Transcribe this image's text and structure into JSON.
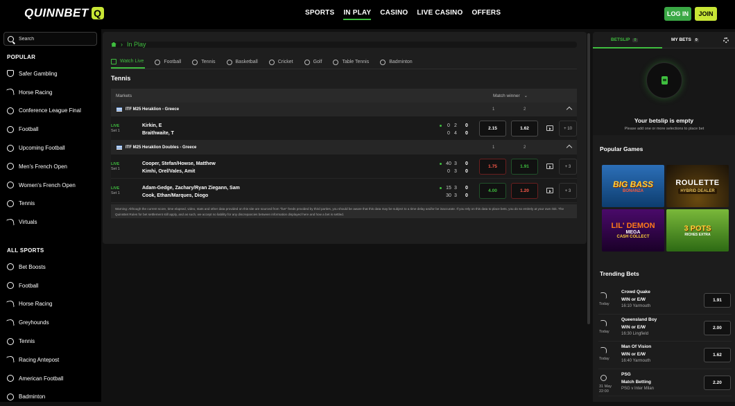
{
  "header": {
    "logo_text": "QUINNBET",
    "logo_mark": "Q",
    "nav": [
      "SPORTS",
      "IN PLAY",
      "CASINO",
      "LIVE CASINO",
      "OFFERS"
    ],
    "active_nav": "IN PLAY",
    "login_label": "LOG IN",
    "join_label": "JOIN",
    "accent_color": "#3fbf3f",
    "join_color": "#c8e635"
  },
  "sidebar": {
    "search_placeholder": "Search",
    "popular_title": "POPULAR",
    "popular": [
      {
        "label": "Safer Gambling",
        "icon": "shield-icon"
      },
      {
        "label": "Horse Racing",
        "icon": "horse-icon"
      },
      {
        "label": "Conference League Final",
        "icon": "football-icon"
      },
      {
        "label": "Football",
        "icon": "football-icon"
      },
      {
        "label": "Upcoming Football",
        "icon": "football-icon"
      },
      {
        "label": "Men's French Open",
        "icon": "tennis-icon"
      },
      {
        "label": "Women's French Open",
        "icon": "tennis-icon"
      },
      {
        "label": "Tennis",
        "icon": "tennis-icon"
      },
      {
        "label": "Virtuals",
        "icon": "horse-icon"
      }
    ],
    "all_sports_title": "ALL SPORTS",
    "all_sports": [
      {
        "label": "Bet Boosts",
        "icon": "boost-icon"
      },
      {
        "label": "Football",
        "icon": "football-icon"
      },
      {
        "label": "Horse Racing",
        "icon": "horse-icon"
      },
      {
        "label": "Greyhounds",
        "icon": "greyhound-icon"
      },
      {
        "label": "Tennis",
        "icon": "tennis-icon"
      },
      {
        "label": "Racing Antepost",
        "icon": "horse-icon"
      },
      {
        "label": "American Football",
        "icon": "american-football-icon"
      },
      {
        "label": "Badminton",
        "icon": "badminton-icon"
      }
    ]
  },
  "main": {
    "breadcrumb": "In Play",
    "tabs": [
      {
        "label": "Watch Live",
        "icon": "tv-icon",
        "active": true
      },
      {
        "label": "Football",
        "icon": "football-icon",
        "active": false
      },
      {
        "label": "Tennis",
        "icon": "tennis-icon",
        "active": false
      },
      {
        "label": "Basketball",
        "icon": "basketball-icon",
        "active": false
      },
      {
        "label": "Cricket",
        "icon": "cricket-icon",
        "active": false
      },
      {
        "label": "Golf",
        "icon": "golf-icon",
        "active": false
      },
      {
        "label": "Table Tennis",
        "icon": "table-tennis-icon",
        "active": false
      },
      {
        "label": "Badminton",
        "icon": "badminton-icon",
        "active": false
      }
    ],
    "sport_heading": "Tennis",
    "table_header": {
      "markets": "Markets",
      "match_winner": "Match winner"
    },
    "competitions": [
      {
        "name": "ITF M25 Heraklion - Greece",
        "col1": "1",
        "col2": "2",
        "events": [
          {
            "live": "LIVE",
            "set": "Set 1",
            "team1": "Kirkin, E",
            "team2": "Braithwaite, T",
            "score1": [
              "0",
              "2",
              "0"
            ],
            "score2": [
              "0",
              "4",
              "0"
            ],
            "odd1": "2.15",
            "odd2": "1.62",
            "odd1_trend": "",
            "odd2_trend": "",
            "more": "+ 10"
          }
        ]
      },
      {
        "name": "ITF M25 Heraklion Doubles - Greece",
        "col1": "1",
        "col2": "2",
        "events": [
          {
            "live": "LIVE",
            "set": "Set 1",
            "team1": "Cooper, Stefan/Howse, Matthew",
            "team2": "Kimhi, Orel/Vales, Amit",
            "score1": [
              "40",
              "3",
              "0"
            ],
            "score2": [
              "0",
              "3",
              "0"
            ],
            "odd1": "1.75",
            "odd2": "1.91",
            "odd1_trend": "down",
            "odd2_trend": "up",
            "more": "+ 3"
          },
          {
            "live": "LIVE",
            "set": "Set 1",
            "team1": "Adam-Gedge, Zachary/Ryan Ziegann, Sam",
            "team2": "Cook, Ethan/Marques, Diogo",
            "score1": [
              "15",
              "3",
              "0"
            ],
            "score2": [
              "30",
              "3",
              "0"
            ],
            "odd1": "4.00",
            "odd2": "1.20",
            "odd1_trend": "up",
            "odd2_trend": "down",
            "more": "+ 3"
          }
        ]
      }
    ],
    "warning": "Warning: Although the current score, time elapsed, video, stats and other data provided on this site are sourced from \"live\" feeds provided by third parties, you should be aware that this data may be subject to a time delay and/or be inaccurate. If you rely on this data to place bets, you do so entirely at your own risk. The QuinnBet Rules for bet settlement still apply, and as such, we accept no liability for any discrepancies between information displayed here and how a bet is settled."
  },
  "betslip": {
    "tab_betslip": "BETSLIP",
    "betslip_count": "0",
    "tab_mybets": "MY BETS",
    "mybets_count": "0",
    "empty_title": "Your betslip is empty",
    "empty_sub": "Please add one or more selections to place bet"
  },
  "popular_games": {
    "title": "Popular Games",
    "games": [
      {
        "line1": "BIG BASS",
        "line2": "BONANZA"
      },
      {
        "line1": "ROULETTE",
        "line2": "HYBRID DEALER"
      },
      {
        "line1": "LIL' DEMON",
        "line2": "MEGA",
        "line3": "CASH COLLECT"
      },
      {
        "line1": "3 POTS",
        "line2": "RICHES EXTRA"
      }
    ]
  },
  "trending_bets": {
    "title": "Trending Bets",
    "items": [
      {
        "name": "Crowd Quake",
        "market": "WIN or E/W",
        "venue": "16:10 Yarmouth",
        "day": "Today",
        "day2": "",
        "price": "1.91",
        "icon": "horse-icon"
      },
      {
        "name": "Queensland Boy",
        "market": "WIN or E/W",
        "venue": "16:30 Lingfield",
        "day": "Today",
        "day2": "",
        "price": "2.00",
        "icon": "horse-icon"
      },
      {
        "name": "Man Of Vision",
        "market": "WIN or E/W",
        "venue": "16:40 Yarmouth",
        "day": "Today",
        "day2": "",
        "price": "1.62",
        "icon": "horse-icon"
      },
      {
        "name": "PSG",
        "market": "Match Betting",
        "venue": "PSG v Inter Milan",
        "day": "31 May",
        "day2": "22:00",
        "price": "2.20",
        "icon": "football-icon"
      }
    ]
  }
}
